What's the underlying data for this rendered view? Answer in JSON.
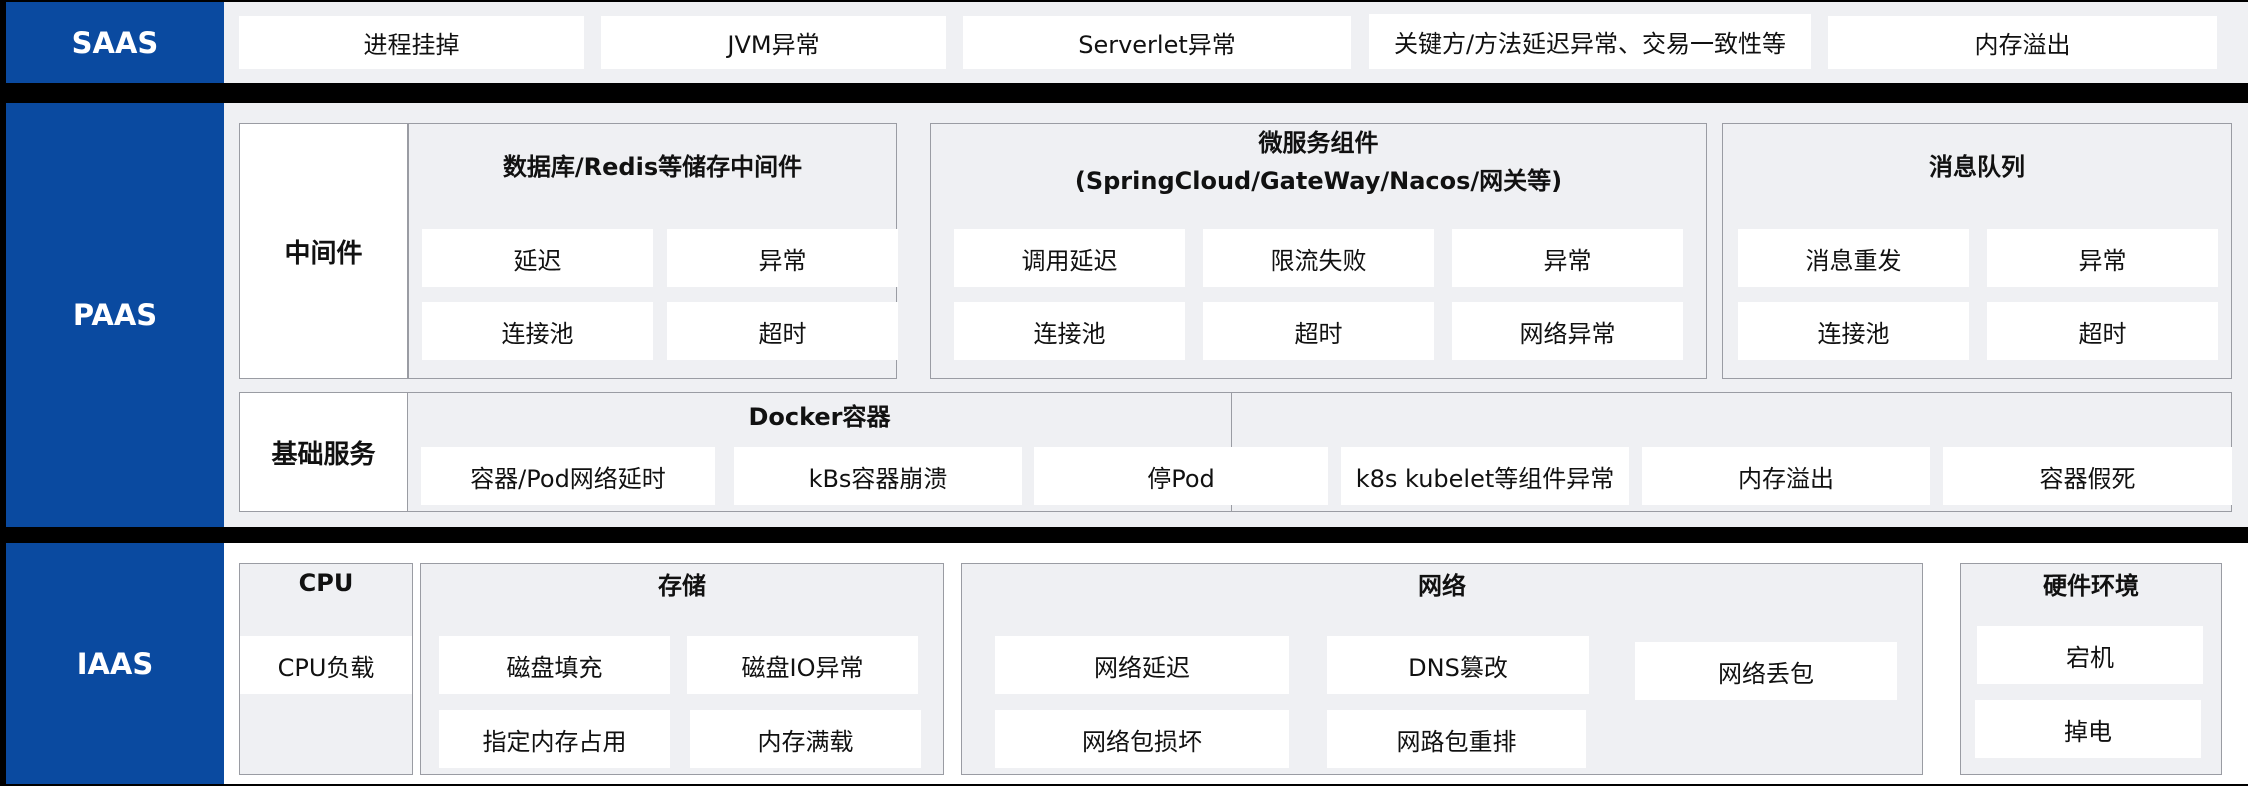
{
  "saas": {
    "label": "SAAS",
    "items": [
      "进程挂掉",
      "JVM异常",
      "Serverlet异常",
      "关键方/方法延迟异常、交易一致性等",
      "内存溢出"
    ]
  },
  "paas": {
    "label": "PAAS",
    "middleware": {
      "label": "中间件",
      "db": {
        "title": "数据库/Redis等储存中间件",
        "items": [
          "延迟",
          "异常",
          "连接池",
          "超时"
        ]
      },
      "micro": {
        "title_line1": "微服务组件",
        "title_line2": "(SpringCloud/GateWay/Nacos/网关等)",
        "items": [
          "调用延迟",
          "限流失败",
          "异常",
          "连接池",
          "超时",
          "网络异常"
        ]
      },
      "mq": {
        "title": "消息队列",
        "items": [
          "消息重发",
          "异常",
          "连接池",
          "超时"
        ]
      }
    },
    "base": {
      "label": "基础服务",
      "docker": {
        "title": "Docker容器",
        "items": [
          "容器/Pod网络延时",
          "kBs容器崩溃",
          "停Pod",
          "k8s kubelet等组件异常",
          "内存溢出",
          "容器假死"
        ]
      }
    }
  },
  "iaas": {
    "label": "IAAS",
    "cpu": {
      "title": "CPU",
      "items": [
        "CPU负载"
      ]
    },
    "storage": {
      "title": "存储",
      "items": [
        "磁盘填充",
        "磁盘IO异常",
        "指定内存占用",
        "内存满载"
      ]
    },
    "network": {
      "title": "网络",
      "items": [
        "网络延迟",
        "DNS篡改",
        "网络丢包",
        "网络包损坏",
        "网路包重排"
      ]
    },
    "hardware": {
      "title": "硬件环境",
      "items": [
        "宕机",
        "掉电"
      ]
    }
  }
}
